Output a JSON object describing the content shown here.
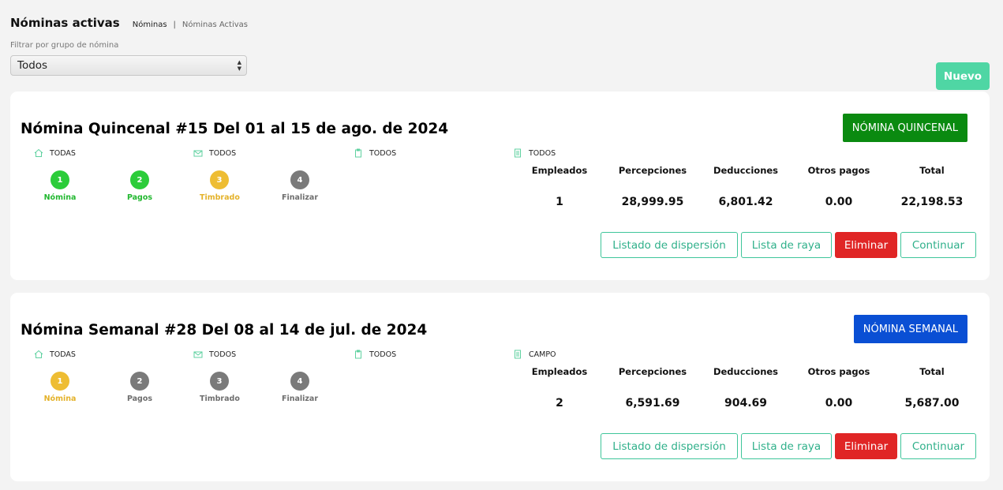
{
  "header": {
    "title": "Nóminas activas",
    "breadcrumb_1": "Nóminas",
    "breadcrumb_sep": "|",
    "breadcrumb_2": "Nóminas Activas"
  },
  "filter": {
    "label": "Filtrar por grupo de nómina",
    "selected": "Todos"
  },
  "new_button": "Nuevo",
  "stat_headers": {
    "empleados": "Empleados",
    "percepciones": "Percepciones",
    "deducciones": "Deducciones",
    "otros": "Otros pagos",
    "total": "Total"
  },
  "actions": {
    "dispersion": "Listado de dispersión",
    "raya": "Lista de raya",
    "eliminar": "Eliminar",
    "continuar": "Continuar"
  },
  "payrolls": [
    {
      "title": "Nómina Quincenal #15 Del 01 al 15 de ago. de 2024",
      "type_label": "NÓMINA QUINCENAL",
      "filters": [
        "TODAS",
        "TODOS",
        "TODOS",
        "TODOS"
      ],
      "steps": [
        {
          "num": "1",
          "label": "Nómina",
          "status": "done"
        },
        {
          "num": "2",
          "label": "Pagos",
          "status": "done"
        },
        {
          "num": "3",
          "label": "Timbrado",
          "status": "current"
        },
        {
          "num": "4",
          "label": "Finalizar",
          "status": "pending"
        }
      ],
      "stats": {
        "empleados": "1",
        "percepciones": "28,999.95",
        "deducciones": "6,801.42",
        "otros": "0.00",
        "total": "22,198.53"
      }
    },
    {
      "title": "Nómina Semanal #28 Del 08 al 14 de jul. de 2024",
      "type_label": "NÓMINA SEMANAL",
      "filters": [
        "TODAS",
        "TODOS",
        "TODOS",
        "CAMPO"
      ],
      "steps": [
        {
          "num": "1",
          "label": "Nómina",
          "status": "current"
        },
        {
          "num": "2",
          "label": "Pagos",
          "status": "pending"
        },
        {
          "num": "3",
          "label": "Timbrado",
          "status": "pending"
        },
        {
          "num": "4",
          "label": "Finalizar",
          "status": "pending"
        }
      ],
      "stats": {
        "empleados": "2",
        "percepciones": "6,591.69",
        "deducciones": "904.69",
        "otros": "0.00",
        "total": "5,687.00"
      }
    }
  ],
  "colors": {
    "accent": "#4fd6a4",
    "quincenal": "#0a8a10",
    "semanal": "#0a4fd4",
    "danger": "#e02525",
    "done": "#2ccc3a",
    "current": "#eebd33",
    "pending": "#7a7a7a"
  }
}
